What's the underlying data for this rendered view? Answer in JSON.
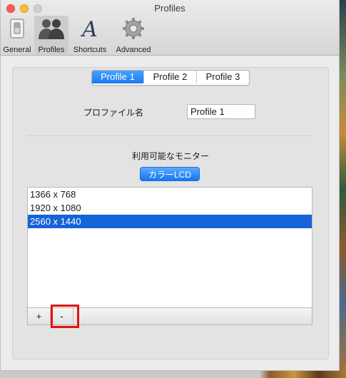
{
  "window": {
    "title": "Profiles"
  },
  "toolbar": {
    "items": [
      {
        "label": "General",
        "icon": "switch-icon"
      },
      {
        "label": "Profiles",
        "icon": "people-icon",
        "selected": true
      },
      {
        "label": "Shortcuts",
        "icon": "font-a-icon"
      },
      {
        "label": "Advanced",
        "icon": "gear-icon"
      }
    ]
  },
  "profile_tabs": [
    "Profile 1",
    "Profile 2",
    "Profile 3"
  ],
  "active_tab": "Profile 1",
  "profile_name": {
    "label": "プロファイル名",
    "value": "Profile 1"
  },
  "monitors": {
    "label": "利用可能なモニター",
    "selected": "カラーLCD"
  },
  "resolutions": [
    "1366 x 768",
    "1920 x 1080",
    "2560 x 1440"
  ],
  "selected_resolution": "2560 x 1440",
  "list_controls": {
    "add": "+",
    "remove": "-"
  },
  "colors": {
    "accent": "#1a78f0",
    "selection": "#1463d8",
    "highlight": "#e21212"
  }
}
